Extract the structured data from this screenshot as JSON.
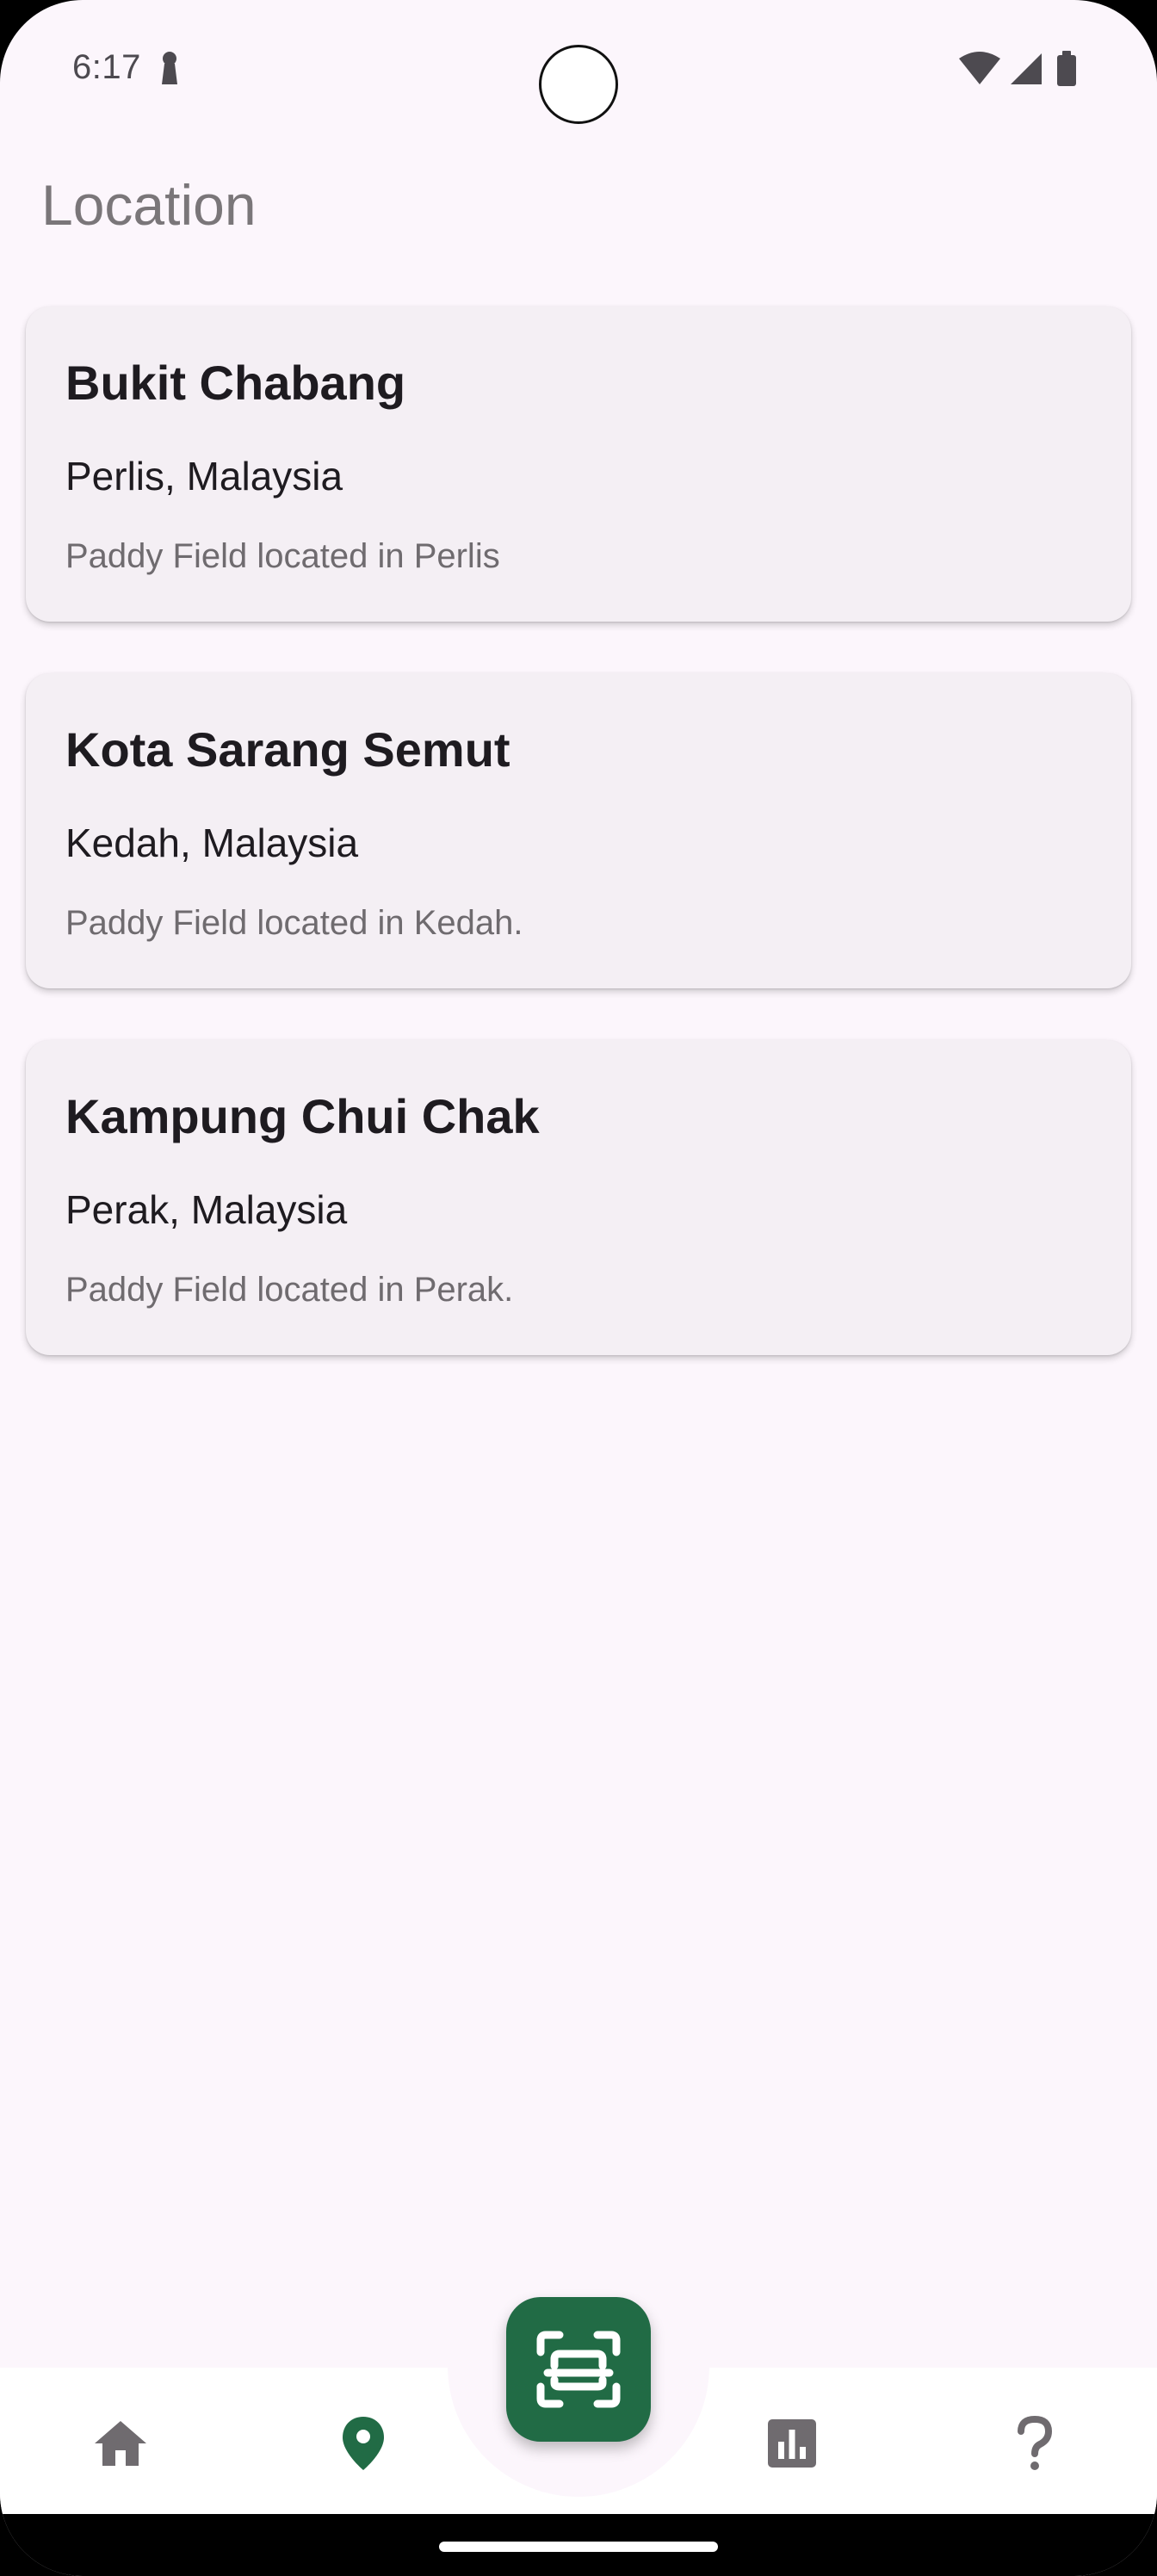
{
  "status_bar": {
    "time": "6:17",
    "icons": [
      "lock-icon",
      "wifi-icon",
      "cellular-signal-icon",
      "battery-icon"
    ]
  },
  "header": {
    "title": "Location"
  },
  "locations": [
    {
      "name": "Bukit Chabang",
      "region": "Perlis, Malaysia",
      "description": "Paddy Field located in Perlis"
    },
    {
      "name": "Kota Sarang Semut",
      "region": "Kedah, Malaysia",
      "description": "Paddy Field located in Kedah."
    },
    {
      "name": "Kampung Chui Chak",
      "region": "Perak, Malaysia",
      "description": "Paddy Field located in Perak."
    }
  ],
  "bottom_nav": {
    "items": [
      {
        "icon": "home-icon",
        "selected": false
      },
      {
        "icon": "location-pin-icon",
        "selected": true
      },
      {
        "icon": "bar-chart-icon",
        "selected": false
      },
      {
        "icon": "help-question-icon",
        "selected": false
      }
    ],
    "fab_icon": "scan-icon"
  },
  "colors": {
    "background": "#fcf6fc",
    "card": "#f4eff4",
    "accent": "#216b45",
    "nav_inactive": "#6f6b6f"
  }
}
